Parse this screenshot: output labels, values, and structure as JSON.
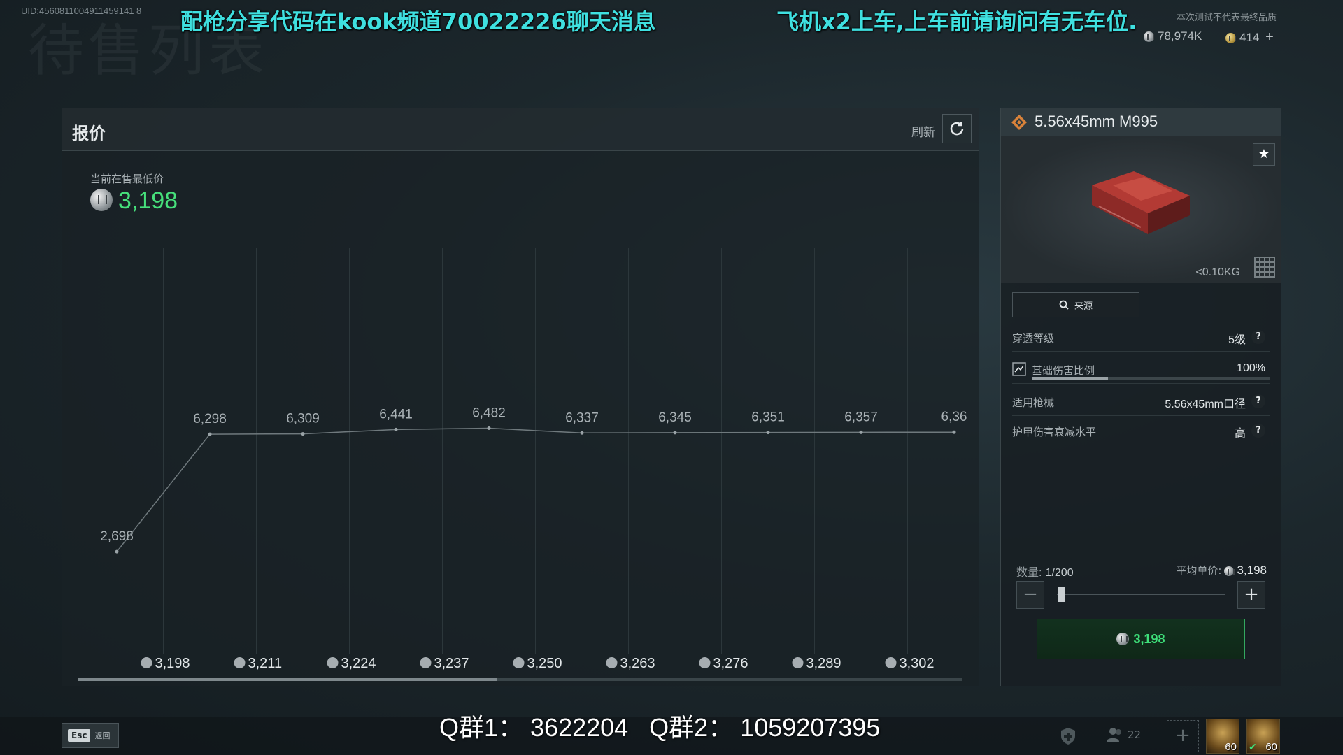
{
  "uid": "UID:4560811004911459141 8",
  "bg_title": "待售列表",
  "overlay": {
    "left": "配枪分享代码在kook频道70022226聊天消息",
    "right": "飞机x2上车,上车前请询问有无车位."
  },
  "disclaimer": "本次测试不代表最终品质",
  "currency": {
    "coins": "78,974K",
    "gold": "414"
  },
  "price_panel": {
    "title": "报价",
    "refresh_label": "刷新",
    "lowest_label": "当前在售最低价",
    "lowest_value": "3,198"
  },
  "chart_data": {
    "type": "line",
    "point_labels": [
      "2,698",
      "6,298",
      "6,309",
      "6,441",
      "6,482",
      "6,337",
      "6,345",
      "6,351",
      "6,357",
      "6,36"
    ],
    "values": [
      2698,
      6298,
      6309,
      6441,
      6482,
      6337,
      6345,
      6351,
      6357,
      6360
    ],
    "x_labels": [
      "3,198",
      "3,211",
      "3,224",
      "3,237",
      "3,250",
      "3,263",
      "3,276",
      "3,289",
      "3,302"
    ],
    "ylim": [
      0,
      12000
    ],
    "grid": true
  },
  "item": {
    "name": "5.56x45mm M995",
    "weight": "<0.10KG",
    "source_label": "来源",
    "attributes": [
      {
        "label": "穿透等级",
        "value": "5级"
      },
      {
        "label": "基础伤害比例",
        "value": "100%",
        "bar": 0.32
      },
      {
        "label": "适用枪械",
        "value": "5.56x45mm口径"
      },
      {
        "label": "护甲伤害衰减水平",
        "value": "高"
      }
    ],
    "quantity_label": "数量:",
    "quantity": "1/200",
    "avg_label": "平均单价:",
    "avg_price": "3,198",
    "quantity_fraction": 0.005,
    "buy_price": "3,198",
    "colors": {
      "buy": "#3ee07a",
      "lowest": "#46e07b"
    }
  },
  "bottom": {
    "esc_key": "Esc",
    "esc_label": "返回",
    "qq_groups": "Q群1： 3622204   Q群2： 1059207395",
    "friends_count": "22",
    "avatar1_level": "60",
    "avatar2_level": "60"
  }
}
